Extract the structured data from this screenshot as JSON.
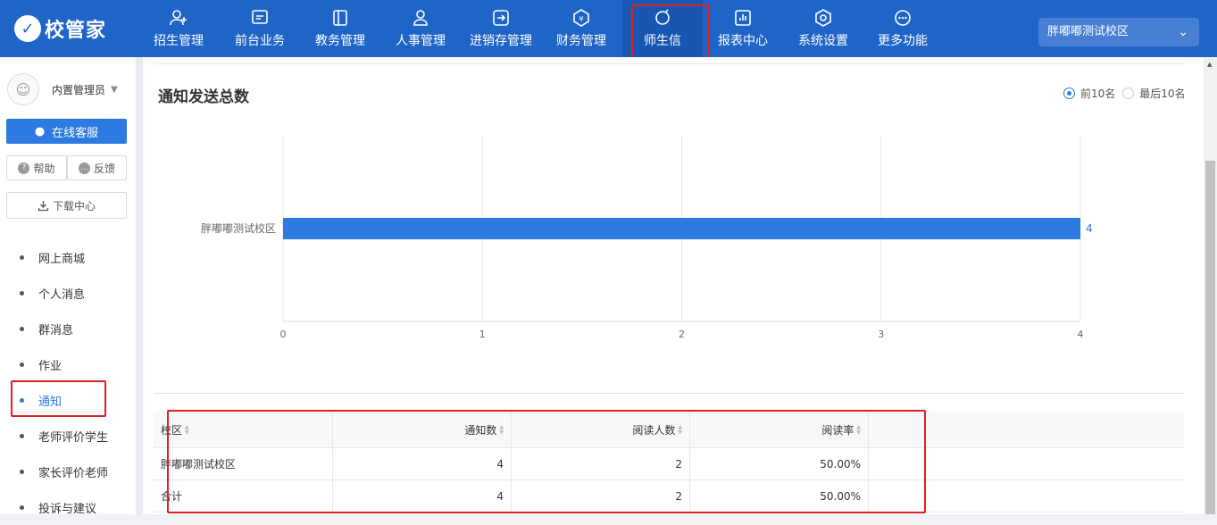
{
  "header": {
    "brand": "校管家",
    "nav": [
      {
        "label": "招生管理",
        "icon": "user-add-icon"
      },
      {
        "label": "前台业务",
        "icon": "monitor-icon"
      },
      {
        "label": "教务管理",
        "icon": "book-icon"
      },
      {
        "label": "人事管理",
        "icon": "person-icon"
      },
      {
        "label": "进销存管理",
        "icon": "inventory-icon"
      },
      {
        "label": "财务管理",
        "icon": "yen-icon"
      },
      {
        "label": "师生信",
        "icon": "message-icon"
      },
      {
        "label": "报表中心",
        "icon": "report-icon"
      },
      {
        "label": "系统设置",
        "icon": "settings-icon"
      },
      {
        "label": "更多功能",
        "icon": "more-icon"
      }
    ],
    "active_nav": "师生信",
    "campus": "胖嘟嘟测试校区"
  },
  "sidebar": {
    "user_name": "内置管理员",
    "service_button": "在线客服",
    "help_button": "帮助",
    "feedback_button": "反馈",
    "download_button": "下载中心",
    "menu": [
      {
        "label": "网上商城"
      },
      {
        "label": "个人消息"
      },
      {
        "label": "群消息"
      },
      {
        "label": "作业"
      },
      {
        "label": "通知"
      },
      {
        "label": "老师评价学生"
      },
      {
        "label": "家长评价老师"
      },
      {
        "label": "投诉与建议"
      }
    ],
    "active_menu": "通知"
  },
  "main": {
    "title": "通知发送总数",
    "radio_top10": "前10名",
    "radio_last10": "最后10名",
    "selected_radio": "前10名"
  },
  "chart_data": {
    "type": "bar",
    "orientation": "horizontal",
    "categories": [
      "胖嘟嘟测试校区"
    ],
    "values": [
      4
    ],
    "xlim": [
      0,
      4
    ],
    "xticks": [
      0,
      1,
      2,
      3,
      4
    ],
    "bar_color": "#2d7ae0",
    "grid": true
  },
  "table": {
    "headers": [
      "校区",
      "通知数",
      "阅读人数",
      "阅读率"
    ],
    "rows": [
      [
        "胖嘟嘟测试校区",
        "4",
        "2",
        "50.00%"
      ],
      [
        "合计",
        "4",
        "2",
        "50.00%"
      ]
    ]
  },
  "colors": {
    "topbar": "#1f65c8",
    "accent": "#2d7ae0",
    "highlight": "#e02020"
  }
}
